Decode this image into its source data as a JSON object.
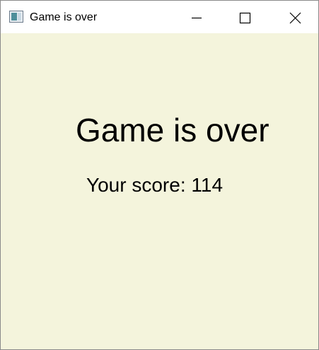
{
  "window": {
    "title": "Game is over",
    "icon": "app-window-icon",
    "controls": {
      "minimize": "minimize-icon",
      "maximize": "maximize-icon",
      "close": "close-icon"
    }
  },
  "main": {
    "headline": "Game is over",
    "score_text": "Your score: 114"
  },
  "colors": {
    "background": "#f4f4dc",
    "titlebar": "#ffffff",
    "text": "#000000"
  }
}
